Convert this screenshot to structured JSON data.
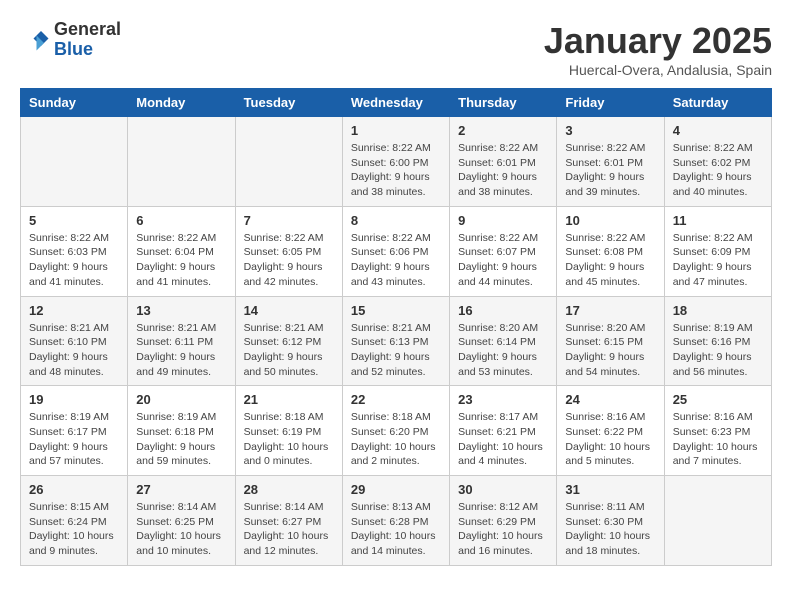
{
  "header": {
    "logo_general": "General",
    "logo_blue": "Blue",
    "title": "January 2025",
    "subtitle": "Huercal-Overa, Andalusia, Spain"
  },
  "days": [
    "Sunday",
    "Monday",
    "Tuesday",
    "Wednesday",
    "Thursday",
    "Friday",
    "Saturday"
  ],
  "weeks": [
    [
      {
        "date": "",
        "info": ""
      },
      {
        "date": "",
        "info": ""
      },
      {
        "date": "",
        "info": ""
      },
      {
        "date": "1",
        "info": "Sunrise: 8:22 AM\nSunset: 6:00 PM\nDaylight: 9 hours and 38 minutes."
      },
      {
        "date": "2",
        "info": "Sunrise: 8:22 AM\nSunset: 6:01 PM\nDaylight: 9 hours and 38 minutes."
      },
      {
        "date": "3",
        "info": "Sunrise: 8:22 AM\nSunset: 6:01 PM\nDaylight: 9 hours and 39 minutes."
      },
      {
        "date": "4",
        "info": "Sunrise: 8:22 AM\nSunset: 6:02 PM\nDaylight: 9 hours and 40 minutes."
      }
    ],
    [
      {
        "date": "5",
        "info": "Sunrise: 8:22 AM\nSunset: 6:03 PM\nDaylight: 9 hours and 41 minutes."
      },
      {
        "date": "6",
        "info": "Sunrise: 8:22 AM\nSunset: 6:04 PM\nDaylight: 9 hours and 41 minutes."
      },
      {
        "date": "7",
        "info": "Sunrise: 8:22 AM\nSunset: 6:05 PM\nDaylight: 9 hours and 42 minutes."
      },
      {
        "date": "8",
        "info": "Sunrise: 8:22 AM\nSunset: 6:06 PM\nDaylight: 9 hours and 43 minutes."
      },
      {
        "date": "9",
        "info": "Sunrise: 8:22 AM\nSunset: 6:07 PM\nDaylight: 9 hours and 44 minutes."
      },
      {
        "date": "10",
        "info": "Sunrise: 8:22 AM\nSunset: 6:08 PM\nDaylight: 9 hours and 45 minutes."
      },
      {
        "date": "11",
        "info": "Sunrise: 8:22 AM\nSunset: 6:09 PM\nDaylight: 9 hours and 47 minutes."
      }
    ],
    [
      {
        "date": "12",
        "info": "Sunrise: 8:21 AM\nSunset: 6:10 PM\nDaylight: 9 hours and 48 minutes."
      },
      {
        "date": "13",
        "info": "Sunrise: 8:21 AM\nSunset: 6:11 PM\nDaylight: 9 hours and 49 minutes."
      },
      {
        "date": "14",
        "info": "Sunrise: 8:21 AM\nSunset: 6:12 PM\nDaylight: 9 hours and 50 minutes."
      },
      {
        "date": "15",
        "info": "Sunrise: 8:21 AM\nSunset: 6:13 PM\nDaylight: 9 hours and 52 minutes."
      },
      {
        "date": "16",
        "info": "Sunrise: 8:20 AM\nSunset: 6:14 PM\nDaylight: 9 hours and 53 minutes."
      },
      {
        "date": "17",
        "info": "Sunrise: 8:20 AM\nSunset: 6:15 PM\nDaylight: 9 hours and 54 minutes."
      },
      {
        "date": "18",
        "info": "Sunrise: 8:19 AM\nSunset: 6:16 PM\nDaylight: 9 hours and 56 minutes."
      }
    ],
    [
      {
        "date": "19",
        "info": "Sunrise: 8:19 AM\nSunset: 6:17 PM\nDaylight: 9 hours and 57 minutes."
      },
      {
        "date": "20",
        "info": "Sunrise: 8:19 AM\nSunset: 6:18 PM\nDaylight: 9 hours and 59 minutes."
      },
      {
        "date": "21",
        "info": "Sunrise: 8:18 AM\nSunset: 6:19 PM\nDaylight: 10 hours and 0 minutes."
      },
      {
        "date": "22",
        "info": "Sunrise: 8:18 AM\nSunset: 6:20 PM\nDaylight: 10 hours and 2 minutes."
      },
      {
        "date": "23",
        "info": "Sunrise: 8:17 AM\nSunset: 6:21 PM\nDaylight: 10 hours and 4 minutes."
      },
      {
        "date": "24",
        "info": "Sunrise: 8:16 AM\nSunset: 6:22 PM\nDaylight: 10 hours and 5 minutes."
      },
      {
        "date": "25",
        "info": "Sunrise: 8:16 AM\nSunset: 6:23 PM\nDaylight: 10 hours and 7 minutes."
      }
    ],
    [
      {
        "date": "26",
        "info": "Sunrise: 8:15 AM\nSunset: 6:24 PM\nDaylight: 10 hours and 9 minutes."
      },
      {
        "date": "27",
        "info": "Sunrise: 8:14 AM\nSunset: 6:25 PM\nDaylight: 10 hours and 10 minutes."
      },
      {
        "date": "28",
        "info": "Sunrise: 8:14 AM\nSunset: 6:27 PM\nDaylight: 10 hours and 12 minutes."
      },
      {
        "date": "29",
        "info": "Sunrise: 8:13 AM\nSunset: 6:28 PM\nDaylight: 10 hours and 14 minutes."
      },
      {
        "date": "30",
        "info": "Sunrise: 8:12 AM\nSunset: 6:29 PM\nDaylight: 10 hours and 16 minutes."
      },
      {
        "date": "31",
        "info": "Sunrise: 8:11 AM\nSunset: 6:30 PM\nDaylight: 10 hours and 18 minutes."
      },
      {
        "date": "",
        "info": ""
      }
    ]
  ]
}
